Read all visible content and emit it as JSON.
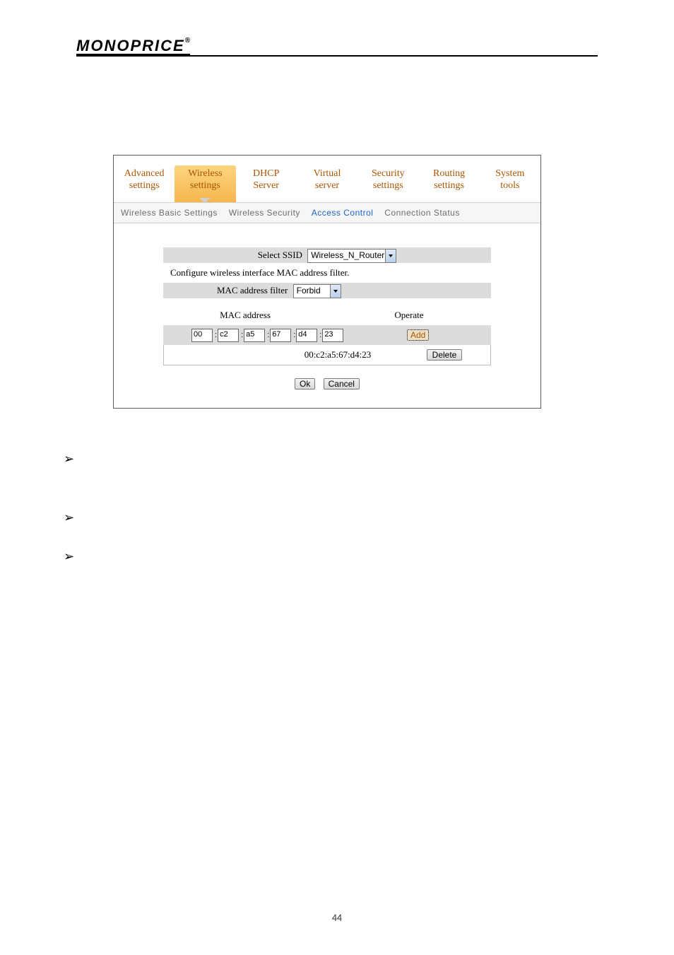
{
  "brand": "MONOPRICE",
  "brand_suffix": "®",
  "tabs": [
    {
      "l1": "Advanced",
      "l2": "settings"
    },
    {
      "l1": "Wireless",
      "l2": "settings"
    },
    {
      "l1": "DHCP",
      "l2": "Server"
    },
    {
      "l1": "Virtual",
      "l2": "server"
    },
    {
      "l1": "Security",
      "l2": "settings"
    },
    {
      "l1": "Routing",
      "l2": "settings"
    },
    {
      "l1": "System",
      "l2": "tools"
    }
  ],
  "subtabs": {
    "basic": "Wireless Basic Settings",
    "security": "Wireless Security",
    "access": "Access Control",
    "status": "Connection Status"
  },
  "ssid_row": {
    "label": "Select SSID",
    "value": "Wireless_N_Router"
  },
  "config_desc": "Configure wireless interface MAC address filter.",
  "filter_row": {
    "label": "MAC address filter",
    "value": "Forbid"
  },
  "columns": {
    "mac": "MAC address",
    "op": "Operate"
  },
  "mac_input": [
    "00",
    "c2",
    "a5",
    "67",
    "d4",
    "23"
  ],
  "buttons": {
    "add": "Add",
    "delete": "Delete",
    "ok": "Ok",
    "cancel": "Cancel"
  },
  "mac_list": [
    "00:c2:a5:67:d4:23"
  ],
  "page_number": "44"
}
